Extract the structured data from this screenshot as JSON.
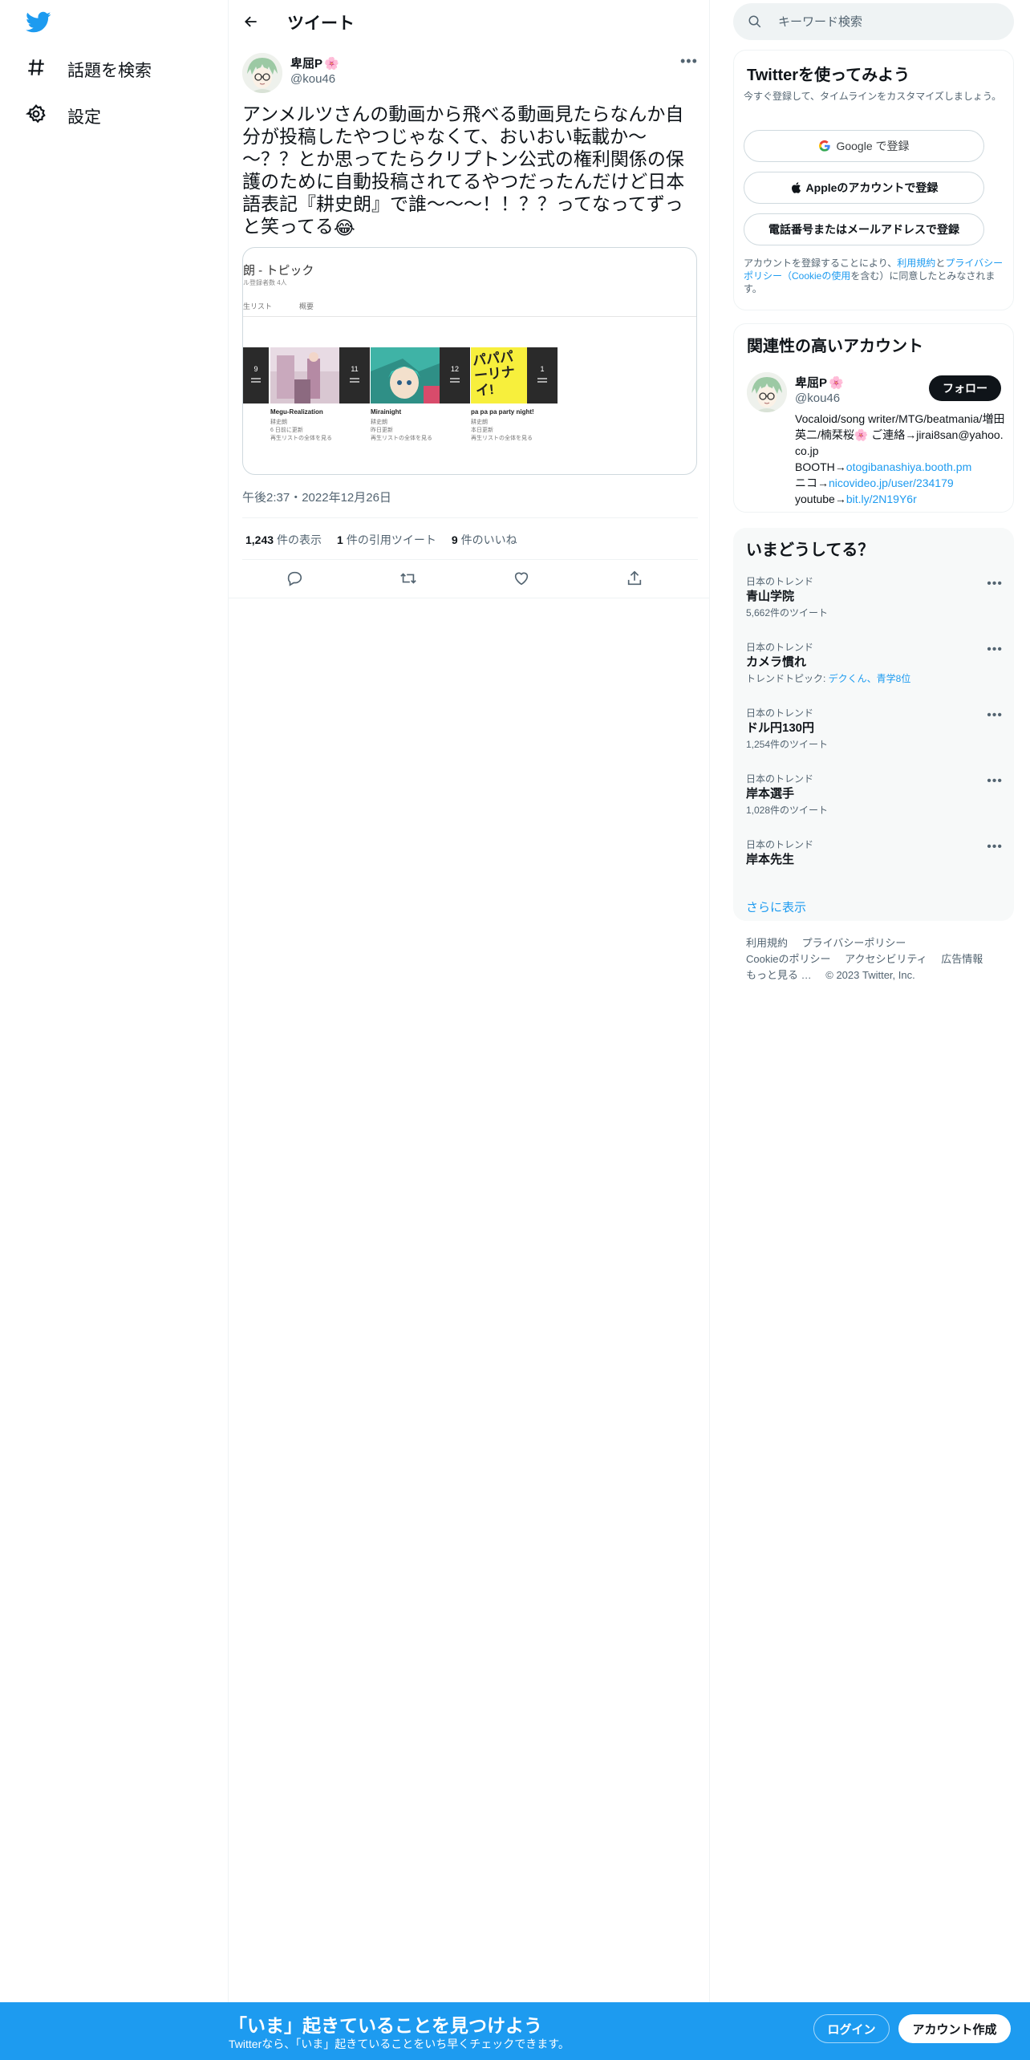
{
  "colors": {
    "accent": "#1d9bf0",
    "text": "#0f1419",
    "secondary": "#536471"
  },
  "nav": {
    "logo_icon": "twitter-bird-icon",
    "items": [
      {
        "label": "話題を検索",
        "icon": "hashtag-icon"
      },
      {
        "label": "設定",
        "icon": "gear-icon"
      }
    ]
  },
  "header": {
    "title": "ツイート",
    "back_icon": "arrow-left-icon"
  },
  "tweet": {
    "author_name": "卑屈P",
    "author_emoji": "🌸",
    "author_handle": "@kou46",
    "text": "アンメルツさんの動画から飛べる動画見たらなんか自分が投稿したやつじゃなくて、おいおい転載か～～？？とか思ってたらクリプトン公式の権利関係の保護のために自動投稿されてるやつだったんだけど日本語表記『耕史朗』で誰～～～！！？？ってなってずっと笑ってる",
    "text_emoji": "😂",
    "timestamp": "午後2:37・2022年12月26日",
    "stats": {
      "views_count": "1,243",
      "views_label": "件の表示",
      "quotes_count": "1",
      "quotes_label": "件の引用ツイート",
      "likes_count": "9",
      "likes_label": "件のいいね"
    },
    "media": {
      "title": "朗 - トピック",
      "subtitle": "ル登録者数 4人",
      "tabs": [
        "生リスト",
        "概要"
      ],
      "playlists": [
        {
          "count": "9",
          "name": "",
          "meta": []
        },
        {
          "count": "11",
          "name": "Megu-Realization",
          "meta": [
            "耕史朗",
            "6 日前に更新",
            "再生リストの全体を見る"
          ]
        },
        {
          "count": "12",
          "name": "Mirainight",
          "meta": [
            "耕史朗",
            "昨日更新",
            "再生リストの全体を見る"
          ]
        },
        {
          "count": "1",
          "name": "pa pa pa party night!",
          "meta": [
            "耕史朗",
            "本日更新",
            "再生リストの全体を見る"
          ]
        }
      ],
      "thumb3_text": "パパパーリナイ!"
    }
  },
  "search": {
    "placeholder": "キーワード検索"
  },
  "signup": {
    "title": "Twitterを使ってみよう",
    "subtitle": "今すぐ登録して、タイムラインをカスタマイズしましょう。",
    "google_label": "Google で登録",
    "apple_label": "Appleのアカウントで登録",
    "phone_label": "電話番号またはメールアドレスで登録",
    "legal_prefix": "アカウントを登録することにより、",
    "legal_terms": "利用規約",
    "legal_and": "と",
    "legal_privacy": "プライバシーポリシー（Cookieの使用",
    "legal_suffix": "を含む）に同意したとみなされます。"
  },
  "relevant": {
    "title": "関連性の高いアカウント",
    "name": "卑屈P",
    "emoji": "🌸",
    "handle": "@kou46",
    "follow_label": "フォロー",
    "bio_line1": "Vocaloid/song writer/MTG/beatmania/増田英二/楠栞桜🌸 ご連絡→jirai8san@yahoo.co.jp",
    "bio_booth_prefix": "BOOTH→",
    "bio_booth_link": "otogibanashiya.booth.pm",
    "bio_nico_prefix": "ニコ→",
    "bio_nico_link": "nicovideo.jp/user/234179",
    "bio_yt_prefix": "youtube→",
    "bio_yt_link": "bit.ly/2N19Y6r"
  },
  "trends": {
    "title": "いまどうしてる？",
    "items": [
      {
        "category": "日本のトレンド",
        "name": "青山学院",
        "meta": "5,662件のツイート"
      },
      {
        "category": "日本のトレンド",
        "name": "カメラ慣れ",
        "meta_prefix": "トレンドトピック: ",
        "meta_link": "デクくん、青学8位"
      },
      {
        "category": "日本のトレンド",
        "name": "ドル円130円",
        "meta": "1,254件のツイート"
      },
      {
        "category": "日本のトレンド",
        "name": "岸本選手",
        "meta": "1,028件のツイート"
      },
      {
        "category": "日本のトレンド",
        "name": "岸本先生",
        "meta": ""
      }
    ],
    "show_more": "さらに表示"
  },
  "footer": {
    "links": [
      "利用規約",
      "プライバシーポリシー",
      "Cookieのポリシー",
      "アクセシビリティ",
      "広告情報",
      "もっと見る …"
    ],
    "copyright": "© 2023 Twitter, Inc."
  },
  "banner": {
    "title": "「いま」起きていることを見つけよう",
    "subtitle": "Twitterなら、「いま」起きていることをいち早くチェックできます。",
    "login_label": "ログイン",
    "signup_label": "アカウント作成"
  }
}
